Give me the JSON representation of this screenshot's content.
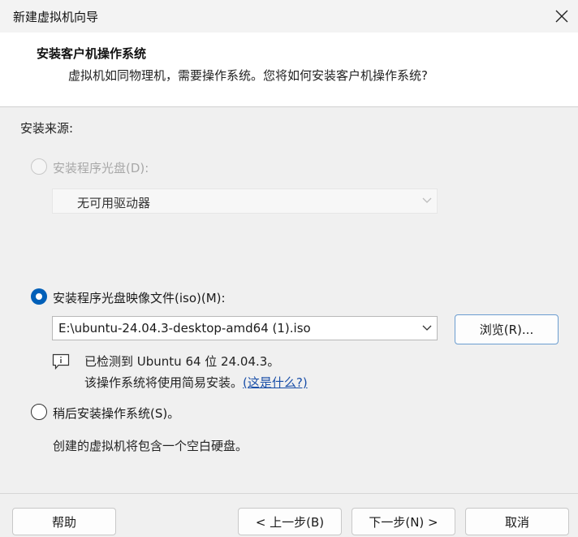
{
  "window": {
    "title": "新建虚拟机向导",
    "close_icon": "close-icon"
  },
  "header": {
    "title": "安装客户机操作系统",
    "subtitle": "虚拟机如同物理机，需要操作系统。您将如何安装客户机操作系统?"
  },
  "install_source": {
    "label": "安装来源:",
    "disc_option": {
      "label": "安装程序光盘(D):",
      "selected": false,
      "enabled": false
    },
    "disc_dropdown": {
      "value": "无可用驱动器",
      "enabled": false
    },
    "iso_option": {
      "label": "安装程序光盘映像文件(iso)(M):",
      "selected": true,
      "enabled": true
    },
    "iso_dropdown": {
      "value": "E:\\ubuntu-24.04.3-desktop-amd64 (1).iso"
    },
    "browse_button": "浏览(R)...",
    "detection": {
      "icon": "info-icon",
      "line1": "已检测到 Ubuntu 64 位 24.04.3。",
      "line2_prefix": "该操作系统将使用简易安装。",
      "link": "(这是什么?)"
    },
    "later_option": {
      "label": "稍后安装操作系统(S)。",
      "selected": false,
      "enabled": true
    },
    "later_description": "创建的虚拟机将包含一个空白硬盘。"
  },
  "footer": {
    "help": "帮助",
    "back": "< 上一步(B)",
    "next": "下一步(N) >",
    "cancel": "取消"
  },
  "colors": {
    "accent": "#005fb8",
    "link": "#1a4fa8",
    "header_bg": "#ffffff",
    "body_bg": "#f0f0f0"
  }
}
